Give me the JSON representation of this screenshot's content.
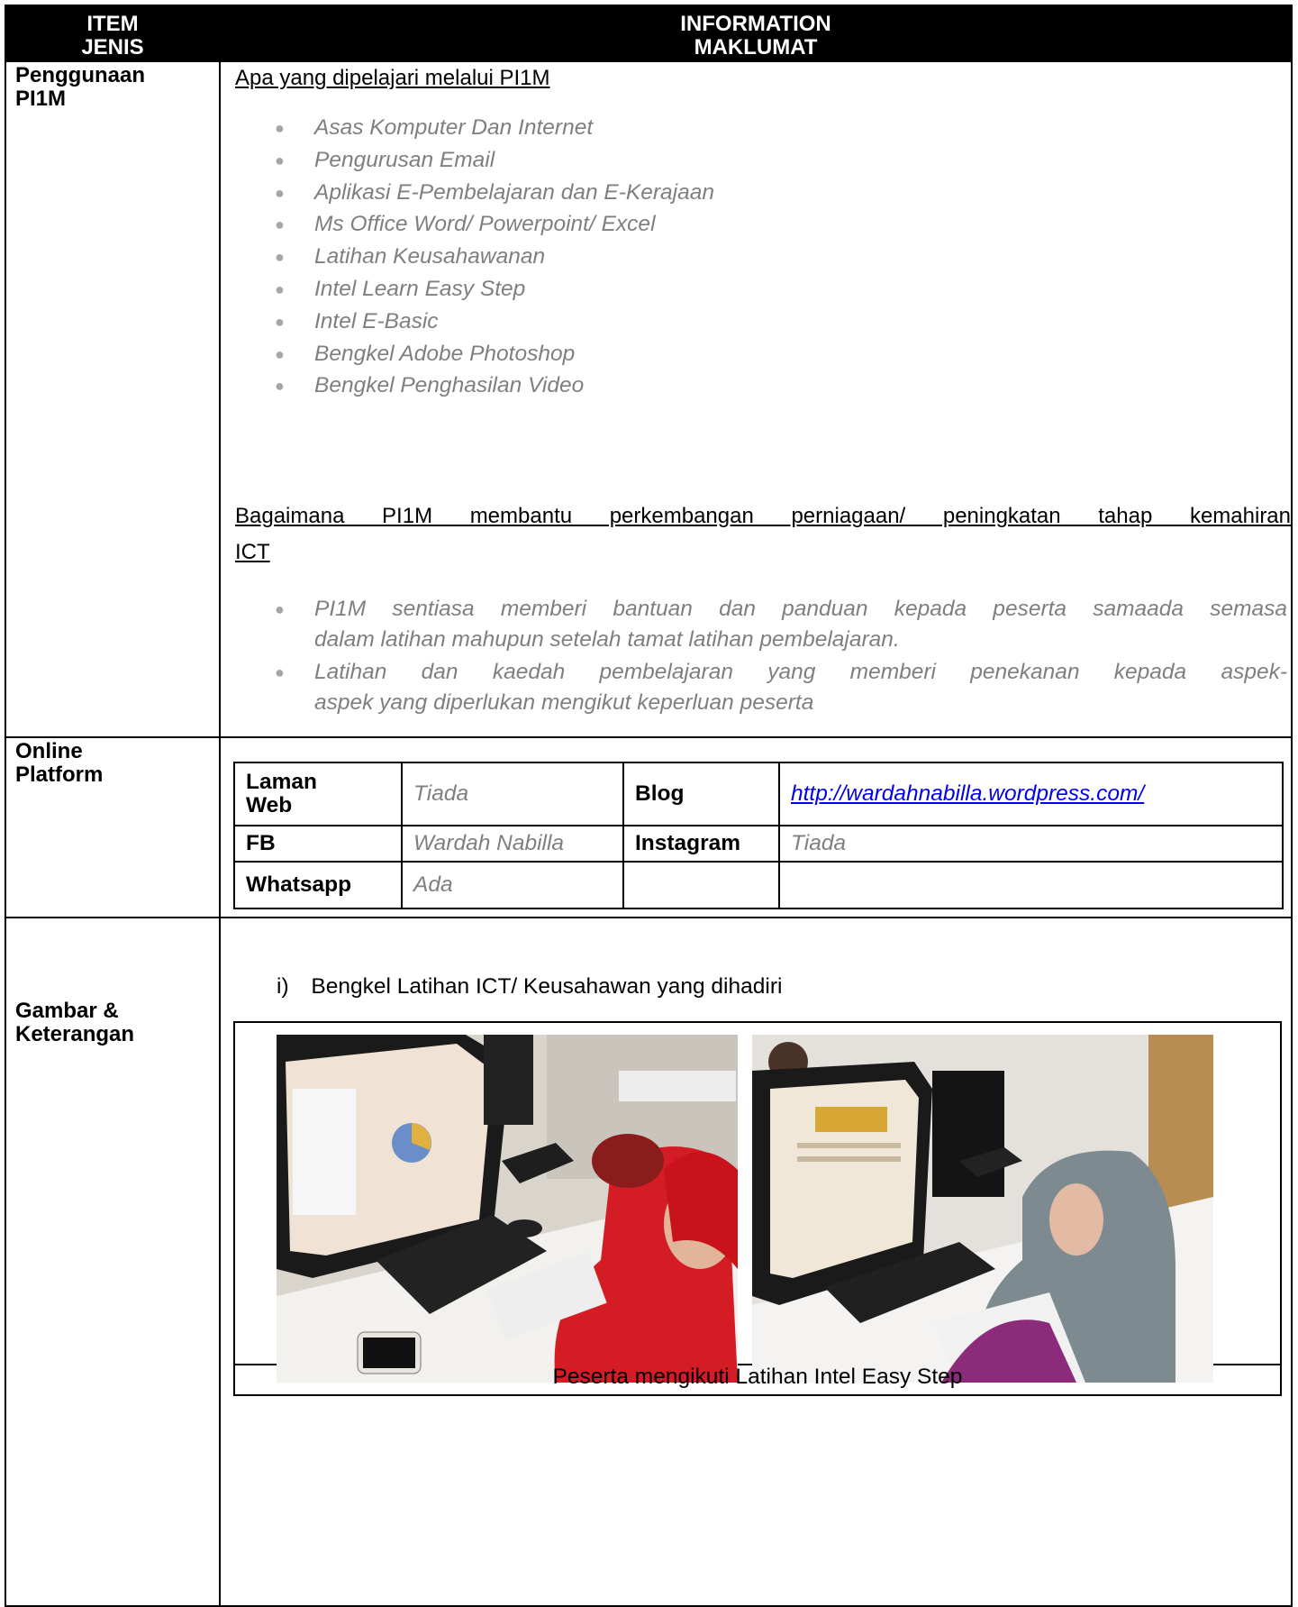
{
  "header": {
    "col1": [
      "ITEM",
      "JENIS"
    ],
    "col2": [
      "INFORMATION",
      "MAKLUMAT"
    ]
  },
  "penggunaan": {
    "label": [
      "Penggunaan",
      "PI1M"
    ],
    "section1_title": "Apa yang dipelajari melalui PI1M",
    "section1_items": [
      "Asas Komputer Dan Internet",
      "Pengurusan Email",
      "Aplikasi E-Pembelajaran dan E-Kerajaan",
      "Ms Office Word/ Powerpoint/ Excel",
      "Latihan Keusahawanan",
      "Intel Learn Easy Step",
      "Intel E-Basic",
      "Bengkel Adobe Photoshop",
      "Bengkel Penghasilan Video"
    ],
    "section2_title_line1": "Bagaimana PI1M membantu perkembangan perniagaan/ peningkatan tahap kemahiran",
    "section2_title_line2": "ICT",
    "section2_items": [
      [
        "PI1M sentiasa memberi bantuan dan panduan kepada peserta samaada semasa",
        "dalam latihan mahupun setelah tamat latihan pembelajaran."
      ],
      [
        "Latihan dan kaedah pembelajaran yang memberi penekanan kepada aspek-",
        "aspek yang diperlukan mengikut keperluan peserta"
      ]
    ]
  },
  "online": {
    "label": [
      "Online",
      "Platform"
    ],
    "laman_web_label": [
      "Laman",
      "Web"
    ],
    "laman_web_value": "Tiada",
    "blog_label": "Blog",
    "blog_value": "http://wardahnabilla.wordpress.com/",
    "fb_label": "FB",
    "fb_value": "Wardah Nabilla",
    "instagram_label": "Instagram",
    "instagram_value": "Tiada",
    "whatsapp_label": "Whatsapp",
    "whatsapp_value": "Ada"
  },
  "gambar": {
    "label": [
      "Gambar &",
      "Keterangan"
    ],
    "item_marker": "i)",
    "item_text": "Bengkel Latihan ICT/ Keusahawan yang dihadiri",
    "caption": "Peserta mengikuti Latihan Intel Easy Step"
  }
}
